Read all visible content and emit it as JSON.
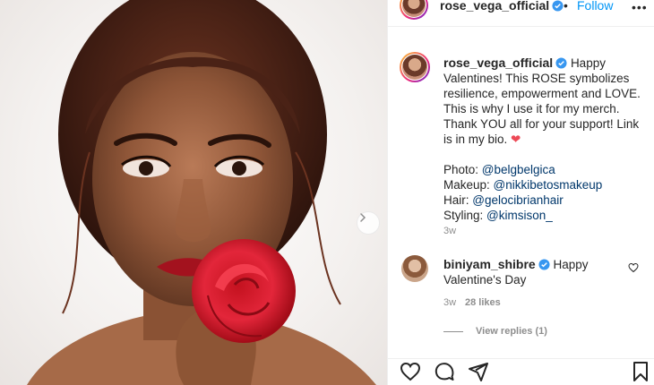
{
  "post": {
    "username": "rose_vega_official",
    "follow_label": "Follow",
    "separator": "•",
    "more_label": "•••",
    "verified_icon": "verified-badge-icon"
  },
  "caption": {
    "username": "rose_vega_official",
    "text": "Happy Valentines! This ROSE symbolizes resilience, empowerment and LOVE. This is why I use it for my merch. Thank YOU all for your support! Link is in my bio.",
    "heart": "❤",
    "credits": [
      {
        "label": "Photo:",
        "handle": "@belgbelgica"
      },
      {
        "label": "Makeup:",
        "handle": "@nikkibetosmakeup"
      },
      {
        "label": "Hair:",
        "handle": "@gelocibrianhair"
      },
      {
        "label": "Styling:",
        "handle": "@kimsison_"
      }
    ],
    "time": "3w"
  },
  "comment": {
    "username": "biniyam_shibre",
    "text": "Happy Valentine's Day",
    "time": "3w",
    "likes": "28 likes",
    "view_replies": "View replies (1)"
  },
  "colors": {
    "link_blue": "#0095f6",
    "mention": "#00376b",
    "muted": "#8e8e8e",
    "heart": "#ed4956"
  },
  "icons": [
    "heart-icon",
    "comment-icon",
    "share-icon",
    "bookmark-icon",
    "chevron-right-icon",
    "like-comment-icon"
  ]
}
